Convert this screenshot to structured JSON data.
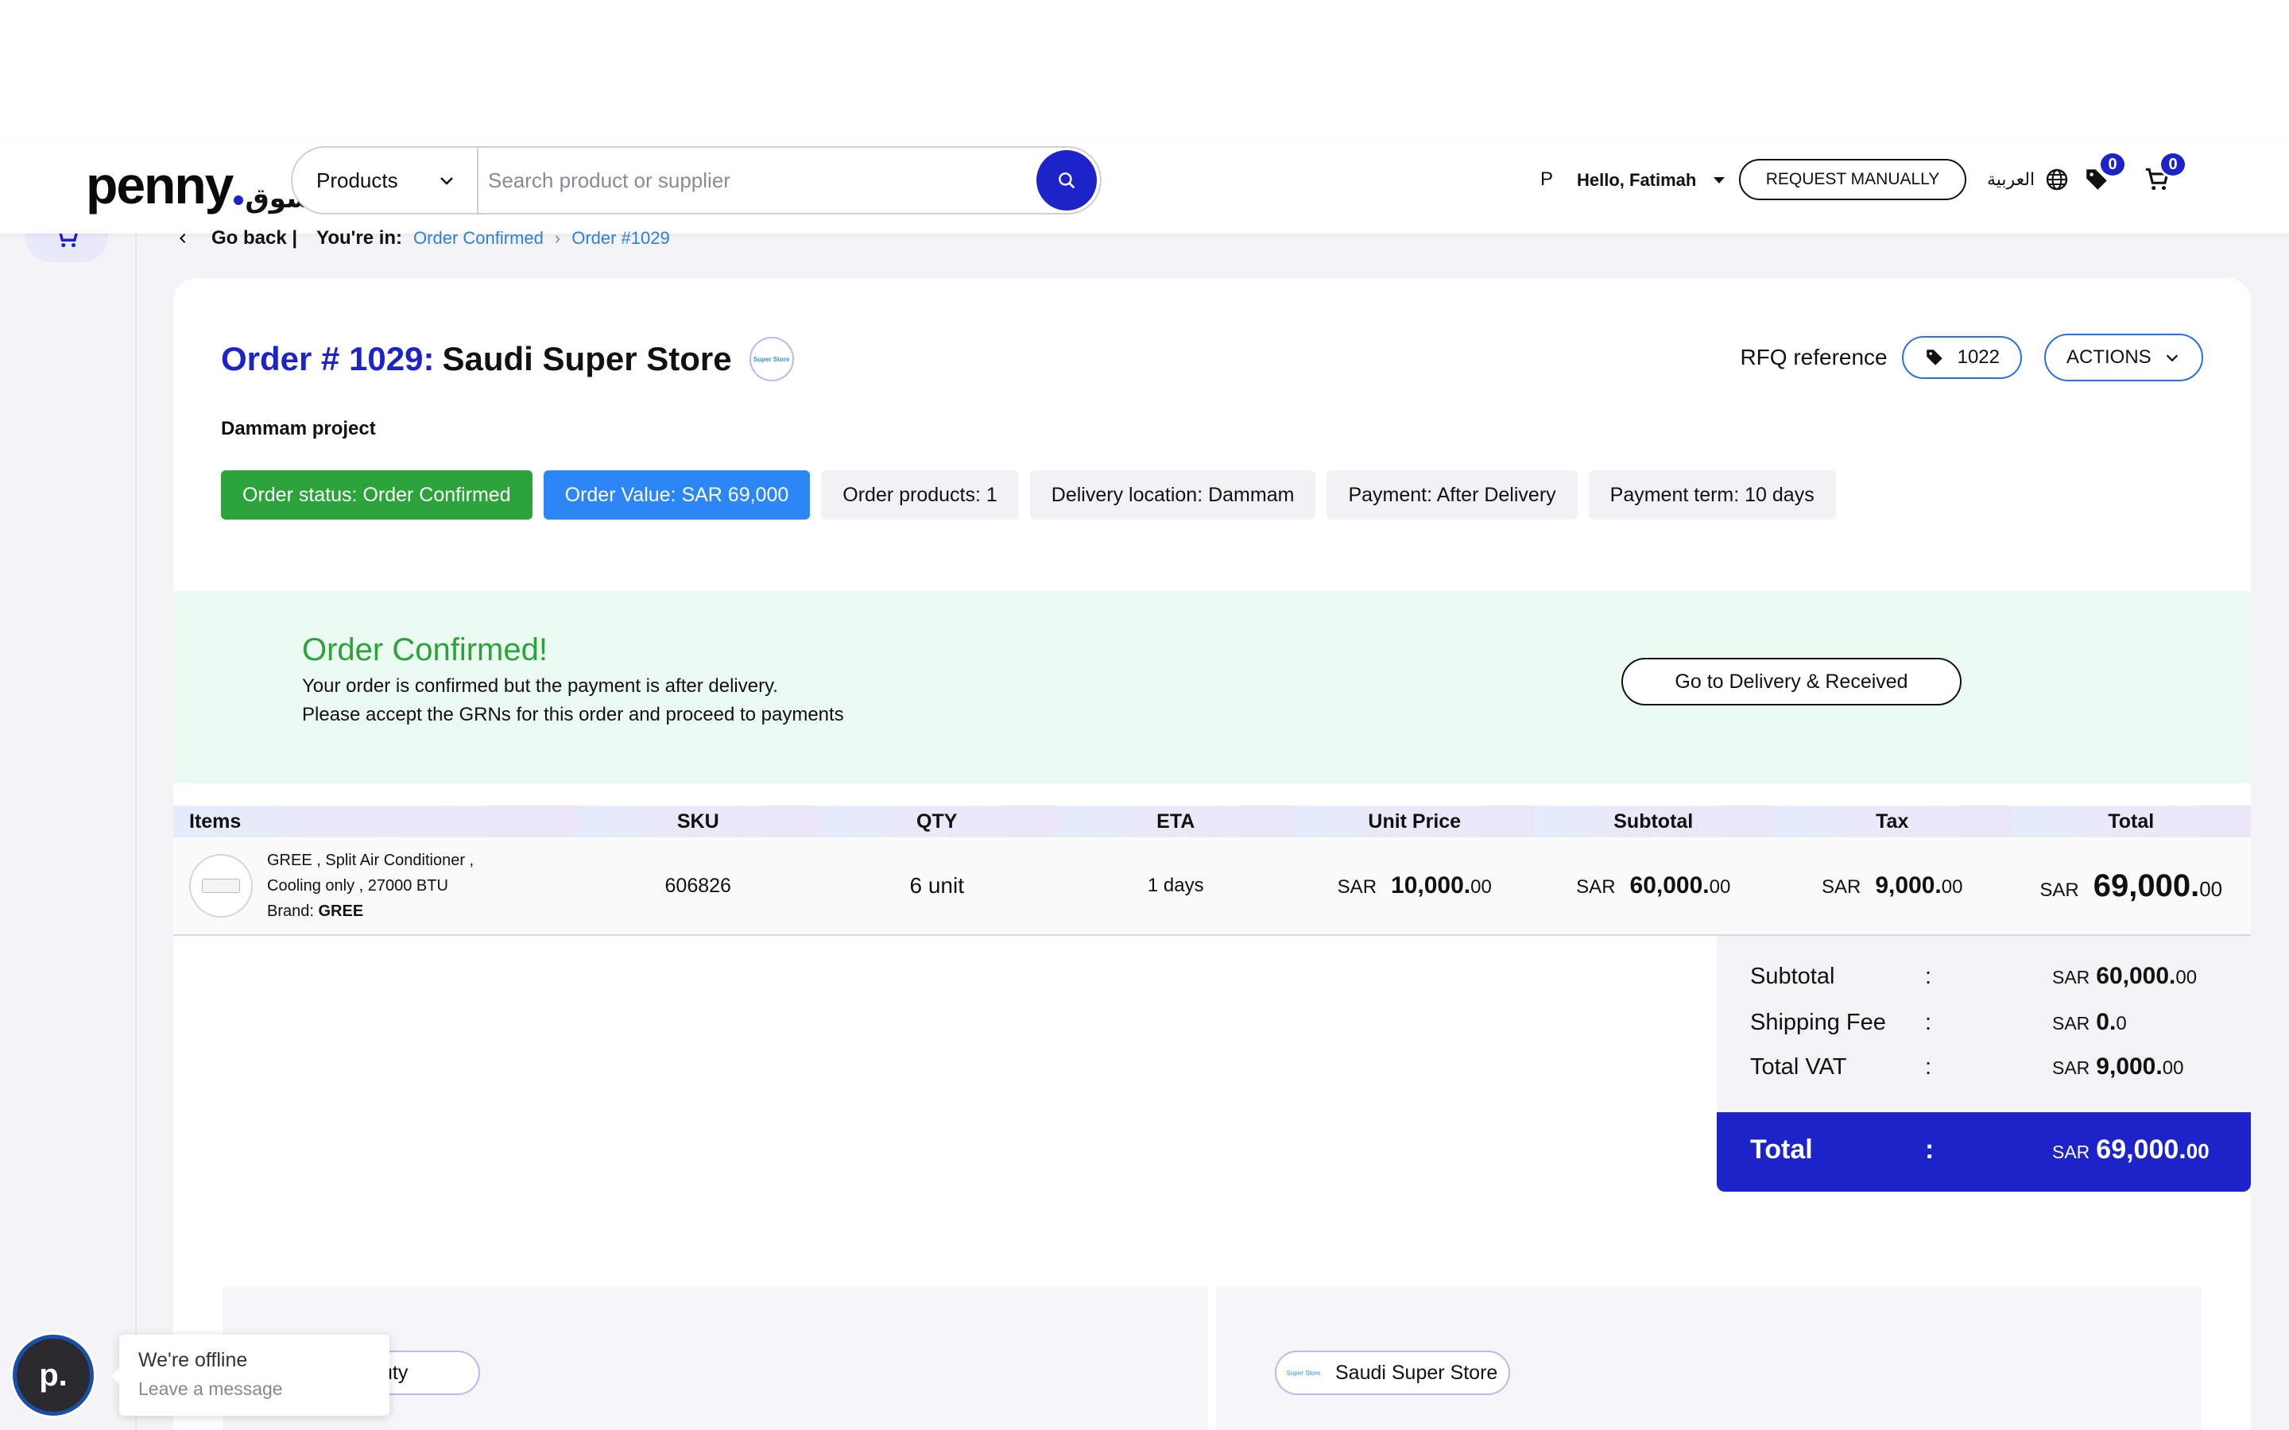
{
  "header": {
    "logo_text": "penny",
    "logo_arabic": "سوق",
    "search_category": "Products",
    "search_placeholder": "Search product or supplier",
    "user_initial": "P",
    "greeting": "Hello, Fatimah",
    "request_button": "REQUEST MANUALLY",
    "language": "العربية",
    "wishlist_count": "0",
    "cart_count": "0"
  },
  "breadcrumb": {
    "back": "Go back |",
    "you_are_in": "You're in:",
    "crumb1": "Order Confirmed",
    "crumb2": "Order #1029"
  },
  "order": {
    "number_label": "Order # 1029:",
    "store_name": "Saudi Super Store",
    "store_logo_text": "Super Store",
    "rfq_label": "RFQ reference",
    "rfq_value": "1022",
    "actions_label": "ACTIONS",
    "project": "Dammam project",
    "chips": {
      "status": "Order status: Order Confirmed",
      "value": "Order Value: SAR 69,000",
      "products": "Order products: 1",
      "location": "Delivery location: Dammam",
      "payment": "Payment: After Delivery",
      "term": "Payment term: 10 days"
    }
  },
  "banner": {
    "title": "Order Confirmed!",
    "line1": "Your order is confirmed but the payment is after delivery.",
    "line2": "Please accept the GRNs for this order and proceed to payments",
    "button": "Go to Delivery & Received"
  },
  "table": {
    "headers": {
      "items": "Items",
      "sku": "SKU",
      "qty": "QTY",
      "eta": "ETA",
      "unit_price": "Unit Price",
      "subtotal": "Subtotal",
      "tax": "Tax",
      "total": "Total"
    },
    "row": {
      "name_line1": "GREE , Split Air Conditioner ,",
      "name_line2": "Cooling only , 27000 BTU",
      "brand_label": "Brand:",
      "brand": "GREE",
      "sku": "606826",
      "qty": "6 unit",
      "eta": "1 days",
      "currency": "SAR",
      "unit_price_int": "10,000.",
      "unit_price_dec": "00",
      "subtotal_int": "60,000.",
      "subtotal_dec": "00",
      "tax_int": "9,000.",
      "tax_dec": "00",
      "total_int": "69,000.",
      "total_dec": "00"
    }
  },
  "summary": {
    "colon": ":",
    "currency": "SAR",
    "subtotal_label": "Subtotal",
    "subtotal_int": "60,000.",
    "subtotal_dec": "00",
    "shipping_label": "Shipping Fee",
    "shipping_int": "0.",
    "shipping_dec": "0",
    "vat_label": "Total VAT",
    "vat_int": "9,000.",
    "vat_dec": "00",
    "total_label": "Total",
    "total_int": "69,000.",
    "total_dec": "00"
  },
  "bottom": {
    "buyer_partial": "uty",
    "supplier_name": "Saudi Super Store",
    "supplier_logo_text": "Super Store"
  },
  "chat": {
    "avatar_letter": "p.",
    "status": "We're offline",
    "prompt": "Leave a message"
  },
  "colors": {
    "brand_blue": "#1c23c9",
    "status_green": "#2ca33a",
    "value_blue": "#2c86f5",
    "banner_bg": "#ecfbf1"
  }
}
